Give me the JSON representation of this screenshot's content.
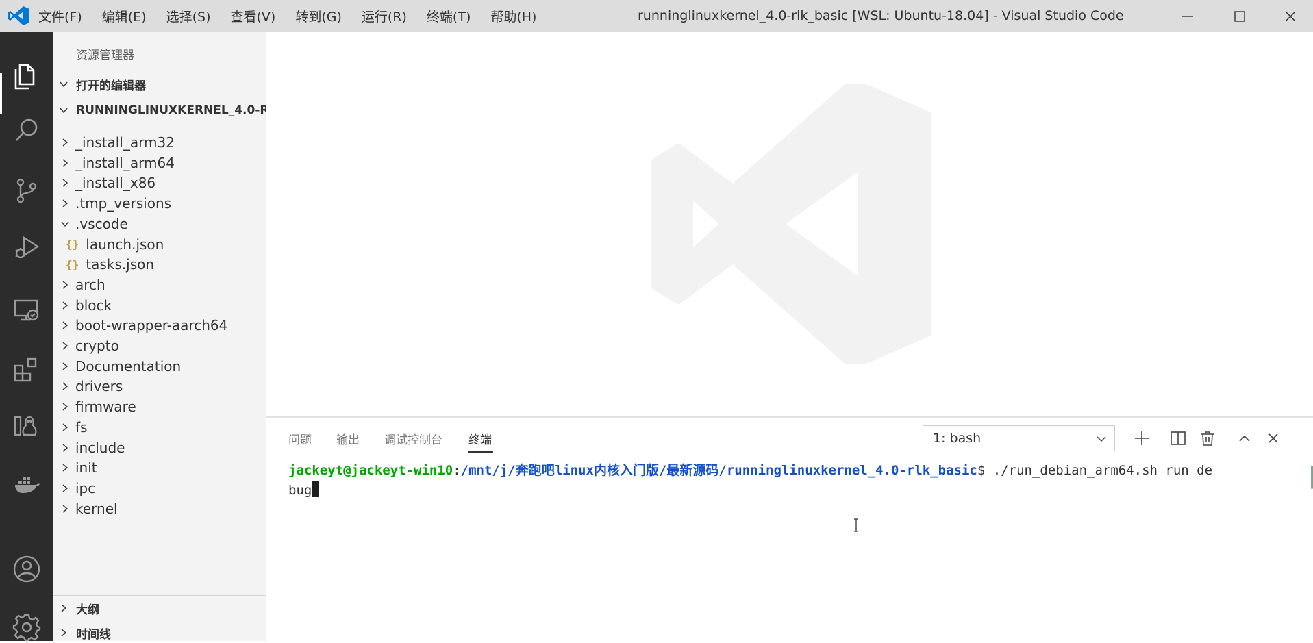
{
  "titlebar": {
    "menu": [
      "文件(F)",
      "编辑(E)",
      "选择(S)",
      "查看(V)",
      "转到(G)",
      "运行(R)",
      "终端(T)",
      "帮助(H)"
    ],
    "window_title": "runninglinuxkernel_4.0-rlk_basic [WSL: Ubuntu-18.04] - Visual Studio Code"
  },
  "activity_bar": {
    "icons": [
      "explorer-icon",
      "search-icon",
      "source-control-icon",
      "run-debug-icon",
      "remote-explorer-icon",
      "extensions-icon",
      "wsl-targets-icon",
      "docker-icon",
      "account-icon",
      "settings-gear-icon"
    ]
  },
  "sidebar": {
    "title": "资源管理器",
    "open_editors": "打开的编辑器",
    "folder_name": "RUNNINGLINUXKERNEL_4.0-R...",
    "tree": [
      {
        "label": "_install_arm32",
        "kind": "folder",
        "expanded": false,
        "depth": 0
      },
      {
        "label": "_install_arm64",
        "kind": "folder",
        "expanded": false,
        "depth": 0
      },
      {
        "label": "_install_x86",
        "kind": "folder",
        "expanded": false,
        "depth": 0
      },
      {
        "label": ".tmp_versions",
        "kind": "folder",
        "expanded": false,
        "depth": 0
      },
      {
        "label": ".vscode",
        "kind": "folder",
        "expanded": true,
        "depth": 0
      },
      {
        "label": "launch.json",
        "kind": "json",
        "depth": 1
      },
      {
        "label": "tasks.json",
        "kind": "json",
        "depth": 1
      },
      {
        "label": "arch",
        "kind": "folder",
        "expanded": false,
        "depth": 0
      },
      {
        "label": "block",
        "kind": "folder",
        "expanded": false,
        "depth": 0
      },
      {
        "label": "boot-wrapper-aarch64",
        "kind": "folder",
        "expanded": false,
        "depth": 0
      },
      {
        "label": "crypto",
        "kind": "folder",
        "expanded": false,
        "depth": 0
      },
      {
        "label": "Documentation",
        "kind": "folder",
        "expanded": false,
        "depth": 0
      },
      {
        "label": "drivers",
        "kind": "folder",
        "expanded": false,
        "depth": 0
      },
      {
        "label": "firmware",
        "kind": "folder",
        "expanded": false,
        "depth": 0
      },
      {
        "label": "fs",
        "kind": "folder",
        "expanded": false,
        "depth": 0
      },
      {
        "label": "include",
        "kind": "folder",
        "expanded": false,
        "depth": 0
      },
      {
        "label": "init",
        "kind": "folder",
        "expanded": false,
        "depth": 0
      },
      {
        "label": "ipc",
        "kind": "folder",
        "expanded": false,
        "depth": 0
      },
      {
        "label": "kernel",
        "kind": "folder",
        "expanded": false,
        "depth": 0
      }
    ],
    "outline": "大纲",
    "timeline": "时间线"
  },
  "panel": {
    "tabs": [
      "问题",
      "输出",
      "调试控制台",
      "终端"
    ],
    "active_tab": "终端",
    "terminal_select": "1: bash",
    "actions": [
      "new-terminal-icon",
      "split-terminal-icon",
      "kill-terminal-icon",
      "maximize-panel-icon",
      "close-panel-icon"
    ]
  },
  "terminal": {
    "user_host": "jackeyt@jackeyt-win10",
    "separator": ":",
    "path": "/mnt/j/奔跑吧linux内核入门版/最新源码/runninglinuxkernel_4.0-rlk_basic",
    "prompt": "$",
    "command_line1": " ./run_debian_arm64.sh run de",
    "command_line2": "bug"
  },
  "colors": {
    "titlebar": "#dddddd",
    "activity_bar": "#2c2c2c",
    "sidebar": "#f3f3f3",
    "terminal_user": "#00a800",
    "terminal_path": "#1450c8",
    "vscode_blue": "#0078d4"
  }
}
